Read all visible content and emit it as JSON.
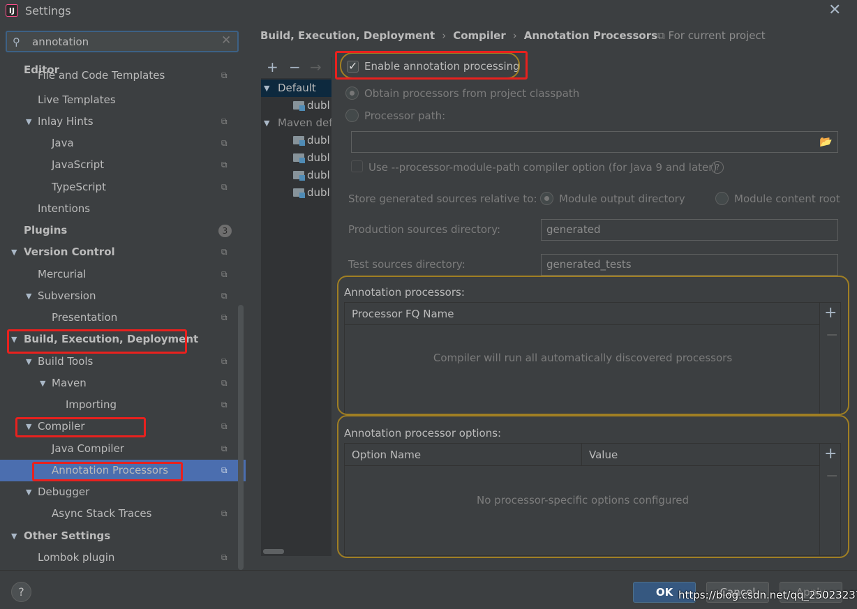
{
  "window": {
    "title": "Settings",
    "app_icon_text": "IJ"
  },
  "search": {
    "value": "annotation",
    "placeholder": ""
  },
  "tree": {
    "editor_header": "Editor",
    "file_templates": "File and Code Templates",
    "live_templates": "Live Templates",
    "inlay_hints": "Inlay Hints",
    "java": "Java",
    "javascript": "JavaScript",
    "typescript": "TypeScript",
    "intentions": "Intentions",
    "plugins": "Plugins",
    "plugins_badge": "3",
    "version_control": "Version Control",
    "mercurial": "Mercurial",
    "subversion": "Subversion",
    "presentation": "Presentation",
    "build": "Build, Execution, Deployment",
    "build_tools": "Build Tools",
    "maven": "Maven",
    "importing": "Importing",
    "compiler": "Compiler",
    "java_compiler": "Java Compiler",
    "annotation_processors": "Annotation Processors",
    "debugger": "Debugger",
    "async_stack_traces": "Async Stack Traces",
    "other_settings": "Other Settings",
    "lombok": "Lombok plugin"
  },
  "breadcrumb": {
    "part1": "Build, Execution, Deployment",
    "part2": "Compiler",
    "part3": "Annotation Processors",
    "sep": "›",
    "for_project": "For current project"
  },
  "profiles": {
    "default": "Default",
    "maven_default": "Maven def",
    "items": [
      "dubl",
      "dubl",
      "dubl",
      "dubl",
      "dubl"
    ]
  },
  "settings": {
    "enable_label": "Enable annotation processing",
    "enable_checked": true,
    "obtain_label": "Obtain processors from project classpath",
    "processor_path_label": "Processor path:",
    "processor_path_value": "",
    "module_path_label": "Use --processor-module-path compiler option (for Java 9 and later)",
    "store_label": "Store generated sources relative to:",
    "module_output_label": "Module output directory",
    "module_content_label": "Module content root",
    "production_label": "Production sources directory:",
    "production_value": "generated",
    "test_label": "Test sources directory:",
    "test_value": "generated_tests"
  },
  "processors": {
    "title": "Annotation processors:",
    "column": "Processor FQ Name",
    "empty": "Compiler will run all automatically discovered processors"
  },
  "options": {
    "title": "Annotation processor options:",
    "col_name": "Option Name",
    "col_value": "Value",
    "empty": "No processor-specific options configured"
  },
  "buttons": {
    "ok": "OK",
    "cancel": "Cancel",
    "apply": "Apply",
    "help": "?"
  },
  "watermark": "https://blog.csdn.net/qq_25023237",
  "colors": {
    "selection": "#4b6eaf",
    "highlight_red": "#e8211e",
    "outline_gold": "#a07f23",
    "ok_button": "#365880"
  }
}
